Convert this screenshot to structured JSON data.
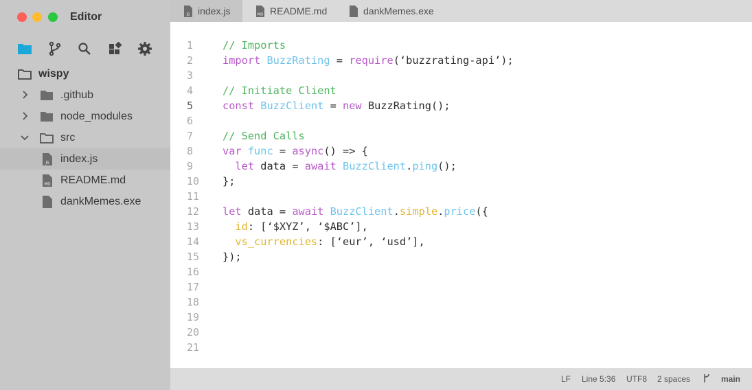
{
  "window": {
    "title": "Editor"
  },
  "toolbar": {
    "icons": [
      "files-icon",
      "branch-icon",
      "search-icon",
      "extensions-icon",
      "settings-icon"
    ]
  },
  "explorer": {
    "root": "wispy",
    "items": [
      {
        "label": ".github",
        "type": "folder",
        "expanded": false
      },
      {
        "label": "node_modules",
        "type": "folder",
        "expanded": false
      },
      {
        "label": "src",
        "type": "folder",
        "expanded": true
      },
      {
        "label": "index.js",
        "type": "file",
        "badge": "JS",
        "selected": true
      },
      {
        "label": "README.md",
        "type": "file",
        "badge": "MD"
      },
      {
        "label": "dankMemes.exe",
        "type": "file"
      }
    ]
  },
  "tabs": [
    {
      "label": "index.js",
      "badge": "JS",
      "active": true
    },
    {
      "label": "README.md",
      "badge": "MD",
      "active": false
    },
    {
      "label": "dankMemes.exe",
      "badge": "",
      "active": false
    }
  ],
  "editor": {
    "line_numbers": [
      "1",
      "2",
      "3",
      "4",
      "5",
      "6",
      "7",
      "8",
      "9",
      "10",
      "11",
      "12",
      "13",
      "14",
      "15",
      "16",
      "17",
      "18",
      "19",
      "20",
      "21"
    ],
    "current_line": "5",
    "lines": [
      [
        [
          "cm",
          "// Imports"
        ]
      ],
      [
        [
          "kw",
          "import "
        ],
        [
          "id",
          "BuzzRating"
        ],
        [
          "st",
          " = "
        ],
        [
          "kw",
          "require"
        ],
        [
          "st",
          "(‘buzzrating-api’);"
        ]
      ],
      [],
      [
        [
          "cm",
          "// Initiate Client"
        ]
      ],
      [
        [
          "kw",
          "const "
        ],
        [
          "id",
          "BuzzClient"
        ],
        [
          "st",
          " = "
        ],
        [
          "kw",
          "new "
        ],
        [
          "st",
          "BuzzRating();"
        ]
      ],
      [],
      [
        [
          "cm",
          "// Send Calls"
        ]
      ],
      [
        [
          "kw",
          "var "
        ],
        [
          "id",
          "func"
        ],
        [
          "st",
          " = "
        ],
        [
          "kw",
          "async"
        ],
        [
          "st",
          "() => {"
        ]
      ],
      [
        [
          "st",
          "  "
        ],
        [
          "kw",
          "let "
        ],
        [
          "st",
          "data = "
        ],
        [
          "kw",
          "await "
        ],
        [
          "id",
          "BuzzClient"
        ],
        [
          "st",
          "."
        ],
        [
          "id",
          "ping"
        ],
        [
          "st",
          "();"
        ]
      ],
      [
        [
          "st",
          "};"
        ]
      ],
      [],
      [
        [
          "kw",
          "let "
        ],
        [
          "st",
          "data = "
        ],
        [
          "kw",
          "await "
        ],
        [
          "id",
          "BuzzClient"
        ],
        [
          "st",
          "."
        ],
        [
          "yl",
          "simple"
        ],
        [
          "st",
          "."
        ],
        [
          "id",
          "price"
        ],
        [
          "st",
          "({"
        ]
      ],
      [
        [
          "st",
          "  "
        ],
        [
          "yl",
          "id"
        ],
        [
          "st",
          ": [‘$XYZ’, ‘$ABC’],"
        ]
      ],
      [
        [
          "st",
          "  "
        ],
        [
          "yl",
          "vs_currencies"
        ],
        [
          "st",
          ": [‘eur’, ‘usd’],"
        ]
      ],
      [
        [
          "st",
          "});"
        ]
      ],
      [],
      [],
      [],
      [],
      [],
      []
    ]
  },
  "status_bar": {
    "eol": "LF",
    "position": "Line 5:36",
    "encoding": "UTF8",
    "indent": "2 spaces",
    "branch": "main"
  },
  "colors": {
    "comment": "#4db35e",
    "keyword": "#b85ac8",
    "identifier": "#6ec3ea",
    "property": "#e2b52a",
    "accent": "#1ba8d8"
  }
}
